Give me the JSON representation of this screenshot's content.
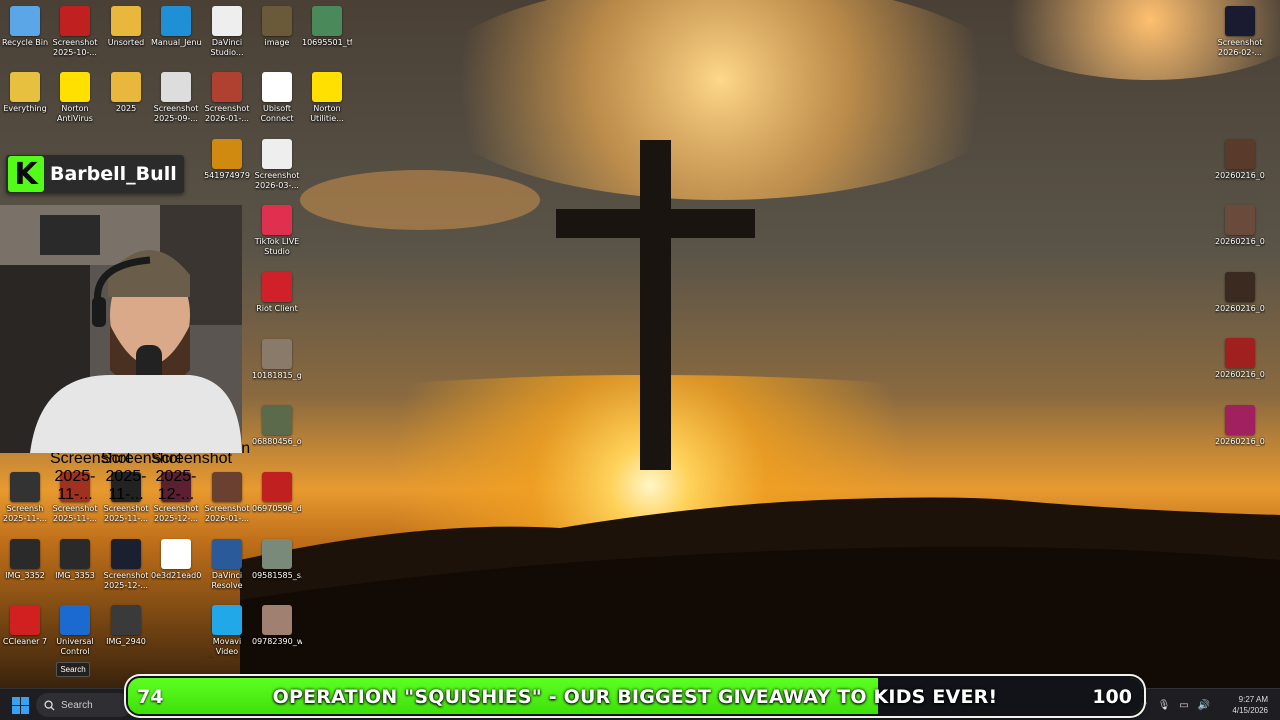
{
  "wallpaper": {
    "colors": {
      "sky_top": "#2b241c",
      "sun": "#fff2b0",
      "glow": "#f0a020",
      "mountain": "#1c120a"
    }
  },
  "desktop": {
    "left_icons": [
      {
        "label": "Recycle Bin",
        "icon": "recycle-bin-icon",
        "color": "#5aa6e6"
      },
      {
        "label": "Screenshot\n2025-10-...",
        "icon": "screenshot-icon",
        "color": "#c02020"
      },
      {
        "label": "Unsorted",
        "icon": "folder-icon",
        "color": "#e8b73c"
      },
      {
        "label": "Manual_Jenu",
        "icon": "edge-icon",
        "color": "#1f8fd6"
      },
      {
        "label": "DaVinci\nStudio...",
        "icon": "file-icon",
        "color": "#eeeeee"
      },
      {
        "label": "image",
        "icon": "image-icon",
        "color": "#6a5a3a"
      },
      {
        "label": "10695501_tff...",
        "icon": "image-icon",
        "color": "#4a8a5a"
      },
      {
        "label": "Everything",
        "icon": "folder-icon",
        "color": "#e8c040"
      },
      {
        "label": "Norton\nAntiVirus",
        "icon": "norton-icon",
        "color": "#ffe000"
      },
      {
        "label": "2025",
        "icon": "folder-icon",
        "color": "#e8b73c"
      },
      {
        "label": "Screenshot\n2025-09-...",
        "icon": "screenshot-icon",
        "color": "#dddddd"
      },
      {
        "label": "Screenshot\n2026-01-...",
        "icon": "screenshot-icon",
        "color": "#b04030"
      },
      {
        "label": "Ubisoft\nConnect",
        "icon": "ubisoft-icon",
        "color": "#ffffff"
      },
      {
        "label": "Norton\nUtilitie...",
        "icon": "norton-utilities-icon",
        "color": "#ffe000"
      },
      {
        "label": "541974979",
        "icon": "image-icon",
        "color": "#d08a10"
      },
      {
        "label": "Screenshot\n2026-03-...",
        "icon": "screenshot-icon",
        "color": "#eeeeee"
      },
      {
        "label": "TikTok LIVE\nStudio",
        "icon": "tiktok-icon",
        "color": "#e03050"
      },
      {
        "label": "Riot Client",
        "icon": "riot-icon",
        "color": "#d0202a"
      },
      {
        "label": "10181815_g...",
        "icon": "image-icon",
        "color": "#8a7a6a"
      },
      {
        "label": "06880456_o...",
        "icon": "image-icon",
        "color": "#5a6a4a"
      },
      {
        "label": "06970596_d...",
        "icon": "image-icon",
        "color": "#c02020"
      },
      {
        "label": "Screensh\n2025-11-...",
        "icon": "screenshot-icon",
        "color": "#333333"
      },
      {
        "label": "Screenshot\n2025-11-...",
        "icon": "screenshot-icon",
        "color": "#a03020"
      },
      {
        "label": "Screenshot\n2025-11-...",
        "icon": "screenshot-icon",
        "color": "#222222"
      },
      {
        "label": "Screenshot\n2025-12-...",
        "icon": "screenshot-icon",
        "color": "#5a2030"
      },
      {
        "label": "Screenshot\n2026-01-...",
        "icon": "screenshot-icon",
        "color": "#6a4030"
      },
      {
        "label": "IMG_3352",
        "icon": "image-icon",
        "color": "#2a2a2a"
      },
      {
        "label": "IMG_3353",
        "icon": "image-icon",
        "color": "#2a2a2a"
      },
      {
        "label": "Screenshot\n2025-12-...",
        "icon": "screenshot-icon",
        "color": "#1a2030"
      },
      {
        "label": "0e3d21ead0...",
        "icon": "image-icon",
        "color": "#ffffff"
      },
      {
        "label": "DaVinci\nResolve",
        "icon": "davinci-icon",
        "color": "#2a5a9a"
      },
      {
        "label": "09581585_s...",
        "icon": "image-icon",
        "color": "#7a8a7a"
      },
      {
        "label": "CCleaner 7",
        "icon": "ccleaner-icon",
        "color": "#d02020"
      },
      {
        "label": "Universal\nControl",
        "icon": "universal-control-icon",
        "color": "#1a6ad0"
      },
      {
        "label": "IMG_2940",
        "icon": "image-icon",
        "color": "#3a3a3a"
      },
      {
        "label": "Movavi Video\nConverter",
        "icon": "movavi-icon",
        "color": "#20a8e8"
      },
      {
        "label": "09782390_w...",
        "icon": "image-icon",
        "color": "#a08070"
      }
    ],
    "right_icons": [
      {
        "label": "Screenshot\n2026-02-...",
        "icon": "screenshot-icon",
        "color": "#1a1a30"
      },
      {
        "label": "20260216_0...",
        "icon": "image-icon",
        "color": "#5a3a2a"
      },
      {
        "label": "20260216_0...",
        "icon": "image-icon",
        "color": "#6a4a3a"
      },
      {
        "label": "20260216_0...",
        "icon": "image-icon",
        "color": "#3a2a20"
      },
      {
        "label": "20260216_0...",
        "icon": "image-icon",
        "color": "#a02020"
      },
      {
        "label": "20260216_0...",
        "icon": "image-icon",
        "color": "#a02060"
      }
    ],
    "hidden_icon_labels": [
      "Screenshot\n2025-11-...",
      "Screenshot\n2025-11-...",
      "Screenshot\n2025-12-...",
      "Camin"
    ]
  },
  "overlay": {
    "channel_logo": "K",
    "channel_name": "Barbell_Bull",
    "brand_color": "#53fc18"
  },
  "giveaway": {
    "current": "74",
    "title": "OPERATION \"SQUISHIES\" - OUR BIGGEST GIVEAWAY TO KIDS EVER!",
    "goal": "100",
    "progress": 0.74,
    "fill_color": "#53fc18",
    "track_color": "#111318"
  },
  "taskbar": {
    "search_tooltip": "Search",
    "search_placeholder": "Search",
    "clock_time": "9:27 AM",
    "clock_date": "4/15/2026",
    "tray_icons": [
      "chevron-up-icon",
      "microphone-icon",
      "network-icon",
      "volume-icon"
    ]
  }
}
